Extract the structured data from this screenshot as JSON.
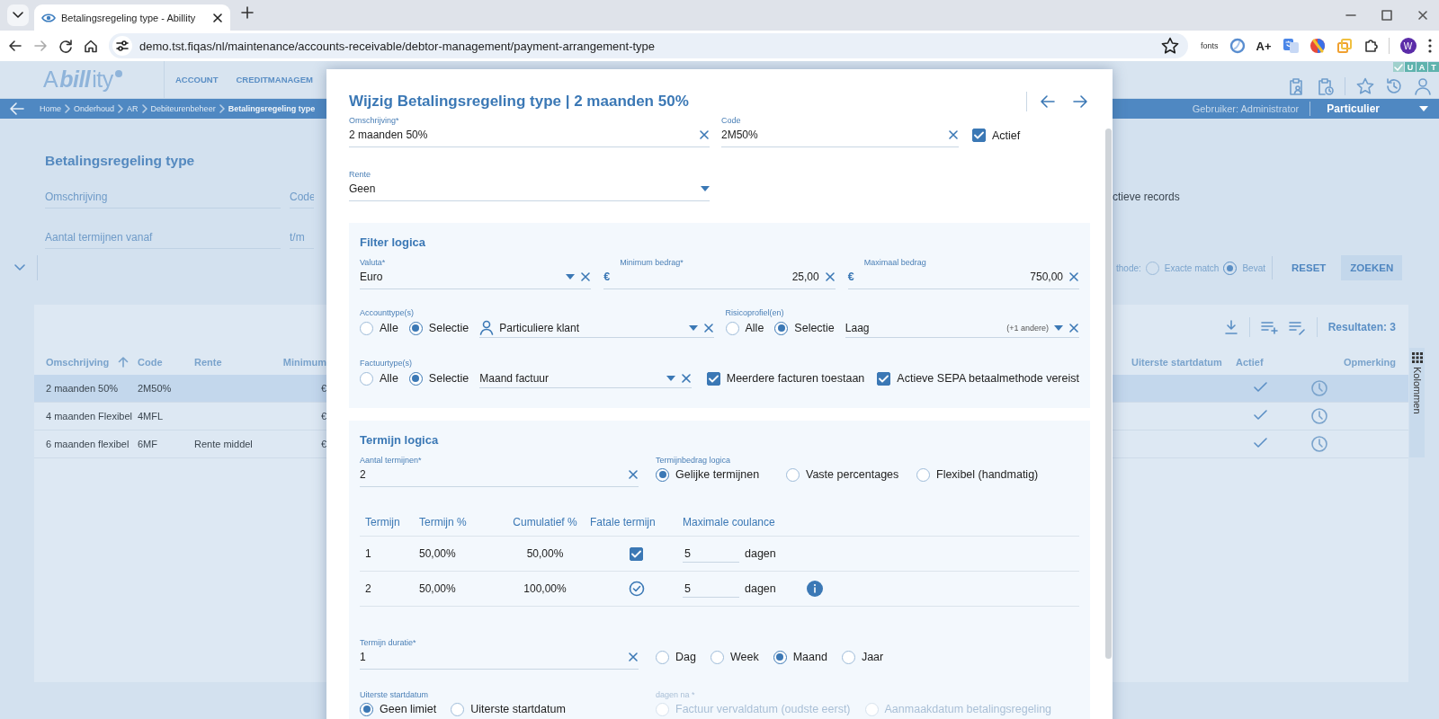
{
  "browser": {
    "tab_title": "Betalingsregeling type - Abillity",
    "address": "demo.tst.fiqas/nl/maintenance/accounts-receivable/debtor-management/payment-arrangement-type",
    "fonts_label": "fonts",
    "font_size_label": "A+",
    "profile_initial": "W"
  },
  "app": {
    "logo": "A**bill**ity",
    "nav": [
      "ACCOUNT",
      "CREDITMANAGEM"
    ],
    "environment": [
      "U",
      "A",
      "T"
    ],
    "breadcrumb": [
      "Home",
      "Onderhoud",
      "AR",
      "Debiteurenbeheer",
      "Betalingsregeling type"
    ],
    "user": "Gebruiker: Administrator",
    "profile": "Particulier"
  },
  "search_panel": {
    "title": "Betalingsregeling type",
    "fields": [
      {
        "placeholder": "Omschrijving"
      },
      {
        "placeholder": "Code"
      },
      {
        "placeholder": "Aantal termijnen vanaf"
      },
      {
        "placeholder": "t/m"
      }
    ],
    "active_records_label": "ctieve records",
    "method_label": "thode:",
    "method_options": [
      {
        "label": "Exacte match",
        "selected": false
      },
      {
        "label": "Bevat",
        "selected": true
      }
    ],
    "buttons": [
      "RESET",
      "ZOEKEN"
    ]
  },
  "results": {
    "count": "Resultaten: 3",
    "columns_left": [
      "Omschrijving",
      "Code",
      "Rente",
      "Minimum"
    ],
    "columns_right": [
      "Uiterste startdatum",
      "Actief",
      "Opmerking"
    ],
    "rows": [
      {
        "omschrijving": "2 maanden 50%",
        "code": "2M50%",
        "minimum": "€",
        "active": true,
        "selected": true
      },
      {
        "omschrijving": "4 maanden Flexibel",
        "code": "4MFL",
        "minimum": "€",
        "active": true,
        "selected": false
      },
      {
        "omschrijving": "6 maanden flexibel",
        "code": "6MF",
        "rente": "Rente middel",
        "minimum": "€",
        "active": true,
        "selected": false
      }
    ],
    "columns_tab": "Kolommen"
  },
  "modal": {
    "title": "Wijzig Betalingsregeling type | 2 maanden 50%",
    "omschrijving": {
      "label": "Omschrijving*",
      "value": "2 maanden 50%"
    },
    "code": {
      "label": "Code",
      "value": "2M50%"
    },
    "actief": {
      "label": "Actief",
      "checked": true
    },
    "rente": {
      "label": "Rente",
      "value": "Geen"
    },
    "filter": {
      "title": "Filter logica",
      "valuta": {
        "label": "Valuta*",
        "value": "Euro"
      },
      "minimum": {
        "label": "Minimum bedrag*",
        "currency": "€",
        "value": "25,00"
      },
      "maximum": {
        "label": "Maximaal bedrag",
        "currency": "€",
        "value": "750,00"
      },
      "accounttypes": {
        "label": "Accounttype(s)",
        "options": [
          {
            "label": "Alle",
            "selected": false
          },
          {
            "label": "Selectie",
            "selected": true
          }
        ],
        "value": "Particuliere klant"
      },
      "risicoprofielen": {
        "label": "Risicoprofiel(en)",
        "options": [
          {
            "label": "Alle",
            "selected": false
          },
          {
            "label": "Selectie",
            "selected": true
          }
        ],
        "value": "Laag",
        "extra": "(+1 andere)"
      },
      "factuurtypes": {
        "label": "Factuurtype(s)",
        "options": [
          {
            "label": "Alle",
            "selected": false
          },
          {
            "label": "Selectie",
            "selected": true
          }
        ],
        "value": "Maand factuur"
      },
      "checks": [
        {
          "label": "Meerdere facturen toestaan",
          "checked": true
        },
        {
          "label": "Actieve SEPA betaalmethode vereist",
          "checked": true
        }
      ]
    },
    "termijn": {
      "title": "Termijn logica",
      "aantal": {
        "label": "Aantal termijnen*",
        "value": "2"
      },
      "bedrag_logica": {
        "label": "Termijnbedrag logica",
        "options": [
          {
            "label": "Gelijke termijnen",
            "selected": true
          },
          {
            "label": "Vaste percentages",
            "selected": false
          },
          {
            "label": "Flexibel (handmatig)",
            "selected": false
          }
        ]
      },
      "table": {
        "columns": [
          "Termijn",
          "Termijn %",
          "Cumulatief %",
          "Fatale termijn",
          "Maximale coulance"
        ],
        "rows": [
          {
            "termijn": "1",
            "percentage": "50,00%",
            "cumulatief": "50,00%",
            "fatal": {
              "kind": "checkbox",
              "checked": true
            },
            "coulance": "5",
            "unit": "dagen",
            "info": false
          },
          {
            "termijn": "2",
            "percentage": "50,00%",
            "cumulatief": "100,00%",
            "fatal": {
              "kind": "fixed",
              "checked": true
            },
            "coulance": "5",
            "unit": "dagen",
            "info": true
          }
        ]
      },
      "duratie": {
        "label": "Termijn duratie*",
        "value": "1",
        "units": [
          {
            "label": "Dag",
            "selected": false
          },
          {
            "label": "Week",
            "selected": false
          },
          {
            "label": "Maand",
            "selected": true
          },
          {
            "label": "Jaar",
            "selected": false
          }
        ]
      },
      "startdatum": {
        "label": "Uiterste startdatum",
        "options": [
          {
            "label": "Geen limiet",
            "selected": true
          },
          {
            "label": "Uiterste startdatum",
            "selected": false
          }
        ]
      },
      "dagen_na": {
        "label": "dagen na *",
        "disabled": true,
        "options": [
          {
            "label": "Factuur vervaldatum (oudste eerst)",
            "selected": false
          },
          {
            "label": "Aanmaakdatum betalingsregeling",
            "selected": false
          }
        ]
      }
    }
  }
}
